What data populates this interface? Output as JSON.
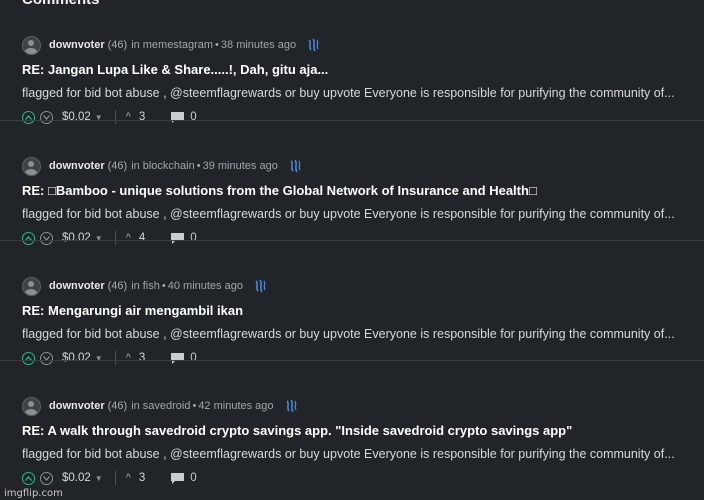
{
  "page": {
    "heading": "Comments"
  },
  "comments": [
    {
      "author": "downvoter",
      "reputation": "(46)",
      "in_label": "in",
      "community": "memestagram",
      "age": "38 minutes ago",
      "title": "RE: Jangan Lupa Like & Share.....!, Dah, gitu aja...",
      "body": "flagged for bid bot abuse , @steemflagrewards or buy upvote Everyone is responsible for purifying the community of...",
      "payout": "$0.02",
      "votes": "3",
      "replies": "0"
    },
    {
      "author": "downvoter",
      "reputation": "(46)",
      "in_label": "in",
      "community": "blockchain",
      "age": "39 minutes ago",
      "title": "RE: □Bamboo - unique solutions from the Global Network of Insurance and Health□",
      "body": "flagged for bid bot abuse , @steemflagrewards or buy upvote Everyone is responsible for purifying the community of...",
      "payout": "$0.02",
      "votes": "4",
      "replies": "0"
    },
    {
      "author": "downvoter",
      "reputation": "(46)",
      "in_label": "in",
      "community": "fish",
      "age": "40 minutes ago",
      "title": "RE: Mengarungi air mengambil ikan",
      "body": "flagged for bid bot abuse , @steemflagrewards or buy upvote Everyone is responsible for purifying the community of...",
      "payout": "$0.02",
      "votes": "3",
      "replies": "0"
    },
    {
      "author": "downvoter",
      "reputation": "(46)",
      "in_label": "in",
      "community": "savedroid",
      "age": "42 minutes ago",
      "title": "RE: A walk through savedroid crypto savings app. \"Inside savedroid crypto savings app\"",
      "body": "flagged for bid bot abuse , @steemflagrewards or buy upvote Everyone is responsible for purifying the community of...",
      "payout": "$0.02",
      "votes": "3",
      "replies": "0"
    }
  ],
  "icons": {
    "upvote": "upvote-icon",
    "downvote": "downvote-icon",
    "votes": "chevron-up-icon",
    "replies": "comment-icon",
    "steem": "steem-logo-icon"
  },
  "colors": {
    "background": "#212529",
    "upvote": "#2bb58c",
    "steem": "#4b86d6"
  },
  "watermark": "imgflip.com"
}
